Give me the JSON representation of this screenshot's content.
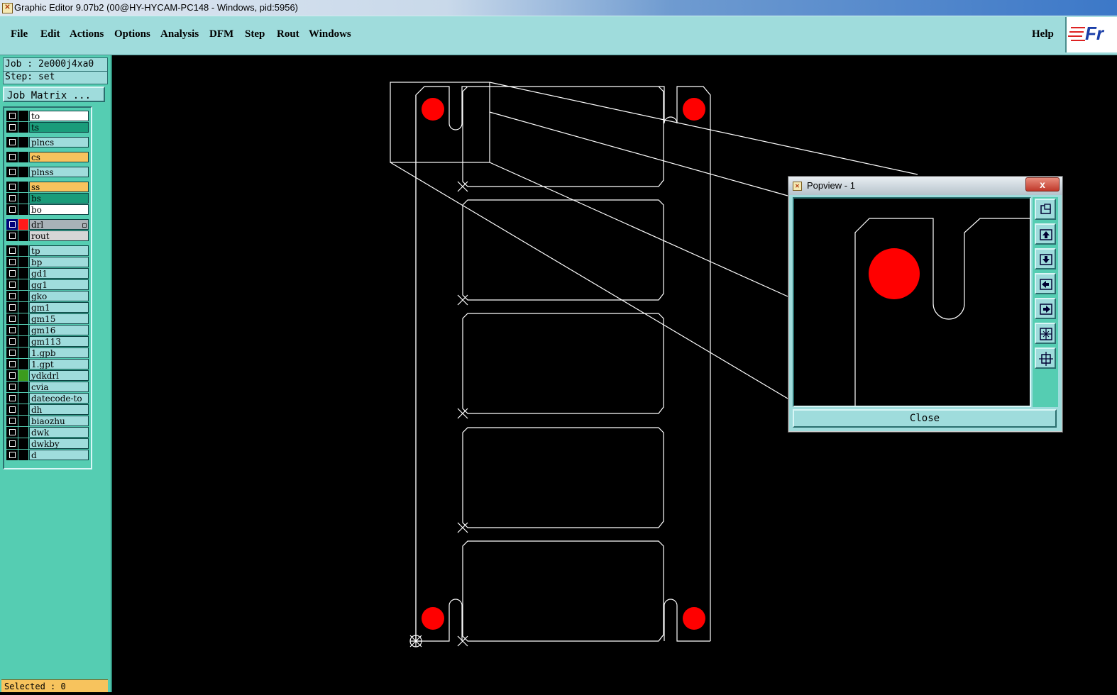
{
  "window": {
    "title": "Graphic Editor 9.07b2 (00@HY-HYCAM-PC148 - Windows, pid:5956)"
  },
  "menu": {
    "items": [
      "File",
      "Edit",
      "Actions",
      "Options",
      "Analysis",
      "DFM",
      "Step",
      "Rout",
      "Windows"
    ],
    "help": "Help"
  },
  "logo": {
    "text": "Fr"
  },
  "job": {
    "job_line": "Job : 2e000j4xa0",
    "step_line": "Step: set",
    "matrix_button": "Job Matrix ..."
  },
  "layers": [
    {
      "name": "to",
      "color": "#ffffff"
    },
    {
      "name": "ts",
      "color": "#1a9c7a"
    },
    {
      "name": "plncs",
      "color": "#9fdcdc"
    },
    {
      "name": "cs",
      "color": "#f7c35d"
    },
    {
      "name": "plnss",
      "color": "#9fdcdc"
    },
    {
      "name": "ss",
      "color": "#f7c35d"
    },
    {
      "name": "bs",
      "color": "#1a9c7a"
    },
    {
      "name": "bo",
      "color": "#ffffff"
    },
    {
      "name": "drl",
      "color": "#a9b2b8",
      "active": true,
      "swatch": "#ff1a1a"
    },
    {
      "name": "rout",
      "color": "#d6d6d6"
    },
    {
      "name": "tp",
      "color": "#9fdcdc"
    },
    {
      "name": "bp",
      "color": "#9fdcdc"
    },
    {
      "name": "gd1",
      "color": "#9fdcdc"
    },
    {
      "name": "gg1",
      "color": "#9fdcdc"
    },
    {
      "name": "gko",
      "color": "#9fdcdc"
    },
    {
      "name": "gm1",
      "color": "#9fdcdc"
    },
    {
      "name": "gm15",
      "color": "#9fdcdc"
    },
    {
      "name": "gm16",
      "color": "#9fdcdc"
    },
    {
      "name": "gm113",
      "color": "#9fdcdc"
    },
    {
      "name": "1.gpb",
      "color": "#9fdcdc"
    },
    {
      "name": "1.gpt",
      "color": "#9fdcdc"
    },
    {
      "name": "ydkdrl",
      "color": "#9fdcdc",
      "swatch": "#3c9c1e"
    },
    {
      "name": "cvia",
      "color": "#9fdcdc"
    },
    {
      "name": "datecode-to",
      "color": "#9fdcdc"
    },
    {
      "name": "dh",
      "color": "#9fdcdc"
    },
    {
      "name": "biaozhu",
      "color": "#9fdcdc"
    },
    {
      "name": "dwk",
      "color": "#9fdcdc"
    },
    {
      "name": "dwkby",
      "color": "#9fdcdc"
    },
    {
      "name": "d",
      "color": "#9fdcdc"
    }
  ],
  "status": {
    "selected": "Selected : 0"
  },
  "popview": {
    "title": "Popview - 1",
    "close_x": "x",
    "close_button": "Close",
    "tools": [
      "zoom-fit-icon",
      "pan-up-icon",
      "pan-down-icon",
      "pan-left-icon",
      "pan-right-icon",
      "zoom-out-icon",
      "zoom-in-icon"
    ]
  },
  "colors": {
    "drill_pad": "#ff0000",
    "outline": "#ffffff",
    "panel_bg": "#55cdb2",
    "menu_bg": "#9fdcdc"
  }
}
